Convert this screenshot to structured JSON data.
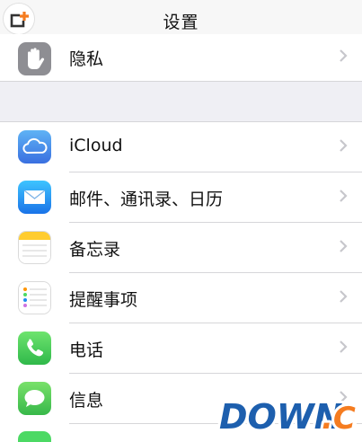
{
  "navbar": {
    "title": "设置"
  },
  "rows": [
    {
      "label": "隐私",
      "icon": "privacy-hand-icon"
    },
    {
      "label": "iCloud",
      "icon": "icloud-icon"
    },
    {
      "label": "邮件、通讯录、日历",
      "icon": "mail-icon"
    },
    {
      "label": "备忘录",
      "icon": "notes-icon"
    },
    {
      "label": "提醒事项",
      "icon": "reminders-icon"
    },
    {
      "label": "电话",
      "icon": "phone-icon"
    },
    {
      "label": "信息",
      "icon": "messages-icon"
    }
  ],
  "watermark": {
    "text": "DOWN.CC"
  },
  "colors": {
    "accent_orange": "#f57c20",
    "icloud_blue": "#4a86e8",
    "mail_blue": "#1e8df0",
    "phone_green": "#4cd964",
    "messages_green": "#5ac85a",
    "privacy_gray": "#8e8e93"
  }
}
